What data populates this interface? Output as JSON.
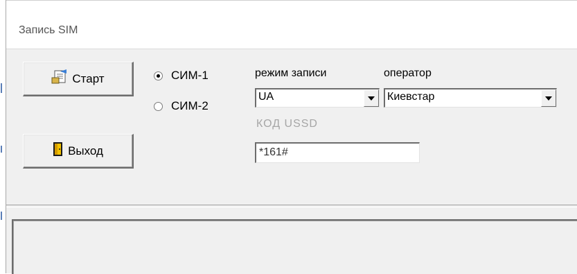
{
  "window": {
    "title": "Запись SIM"
  },
  "buttons": {
    "start_label": "Старт",
    "exit_label": "Выход"
  },
  "sim_select": {
    "options": [
      {
        "label": "СИМ-1",
        "checked": true
      },
      {
        "label": "СИМ-2",
        "checked": false
      }
    ]
  },
  "record_mode": {
    "label": "режим записи",
    "value": "UA"
  },
  "operator": {
    "label": "оператор",
    "value": "Киевстар"
  },
  "ussd": {
    "label": "КОД USSD",
    "value": "*161#"
  },
  "colors": {
    "window_bg": "#f0f0f0",
    "disabled_text": "#a6a6a6"
  }
}
